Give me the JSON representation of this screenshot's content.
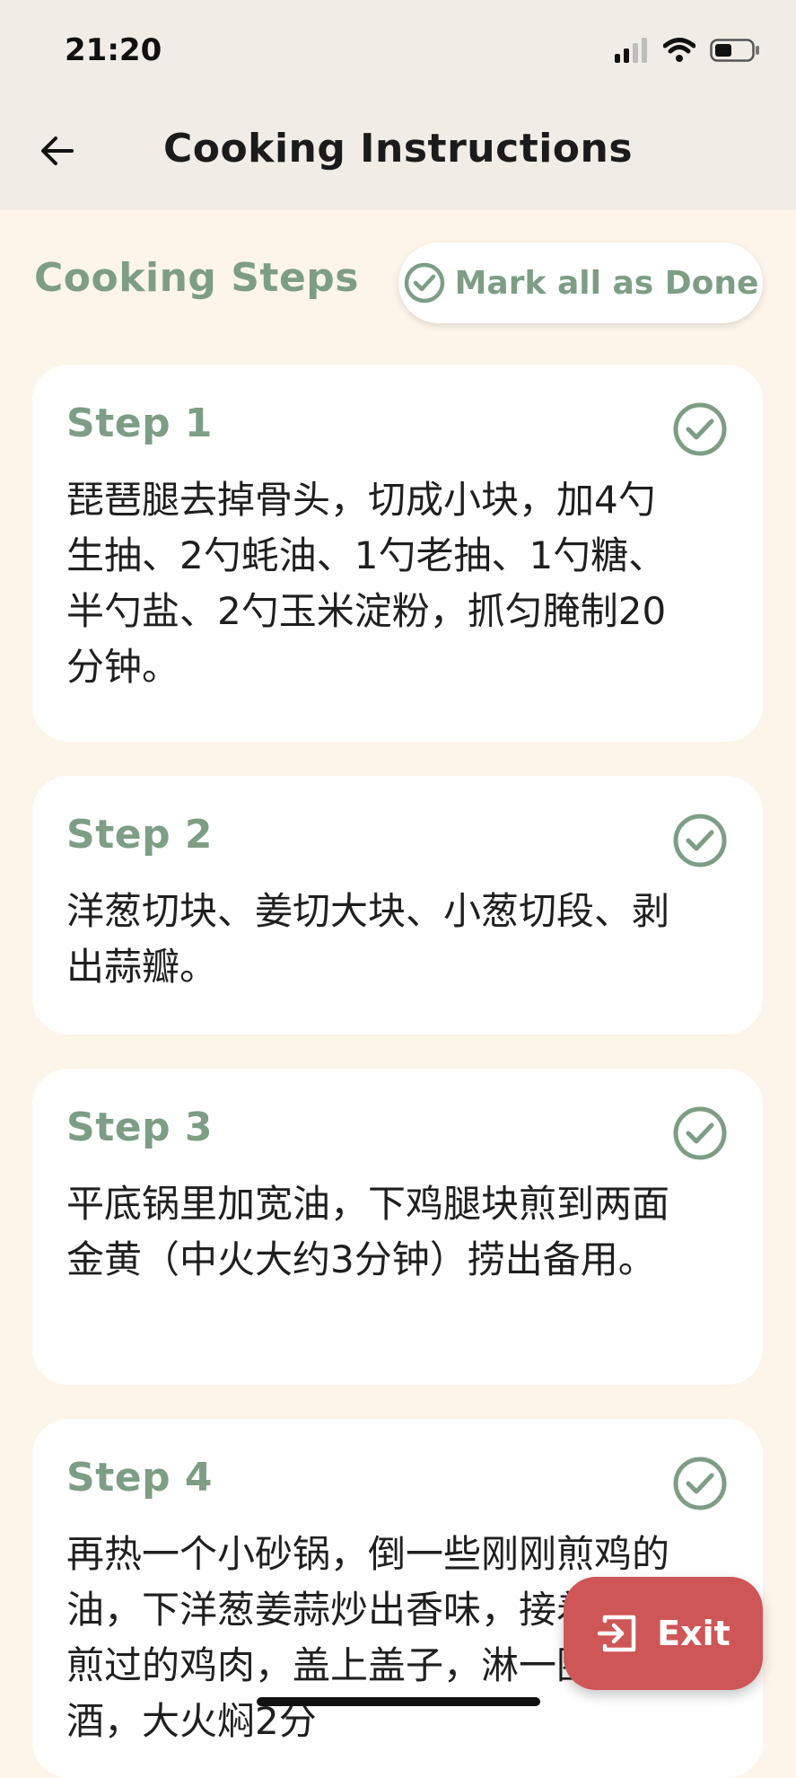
{
  "status_bar": {
    "time": "21:20",
    "icons": [
      "signal-icon",
      "wifi-icon",
      "battery-icon"
    ]
  },
  "header": {
    "back_icon": "arrow-left-icon",
    "title": "Cooking Instructions"
  },
  "section": {
    "title": "Cooking Steps",
    "mark_all_label": "Mark all as Done",
    "mark_all_icon": "check-circle-icon"
  },
  "steps": [
    {
      "title": "Step 1",
      "text": "琵琶腿去掉骨头，切成小块，加4勺生抽、2勺蚝油、1勺老抽、1勺糖、半勺盐、2勺玉米淀粉，抓匀腌制20分钟。"
    },
    {
      "title": "Step 2",
      "text": "洋葱切块、姜切大块、小葱切段、剥出蒜瓣。"
    },
    {
      "title": "Step 3",
      "text": "平底锅里加宽油，下鸡腿块煎到两面金黄（中火大约3分钟）捞出备用。"
    },
    {
      "title": "Step 4",
      "text": "再热一个小砂锅，倒一些刚刚煎鸡的油，下洋葱姜蒜炒出香味，接着铺上煎过的鸡肉，盖上盖子，淋一圈米酒，大火焖2分"
    }
  ],
  "fab": {
    "label": "Exit",
    "icon": "exit-icon"
  },
  "colors": {
    "accent": "#7d9e84",
    "background": "#fdf4ea",
    "header_bg": "#f1ede6",
    "exit": "#cf5656"
  }
}
